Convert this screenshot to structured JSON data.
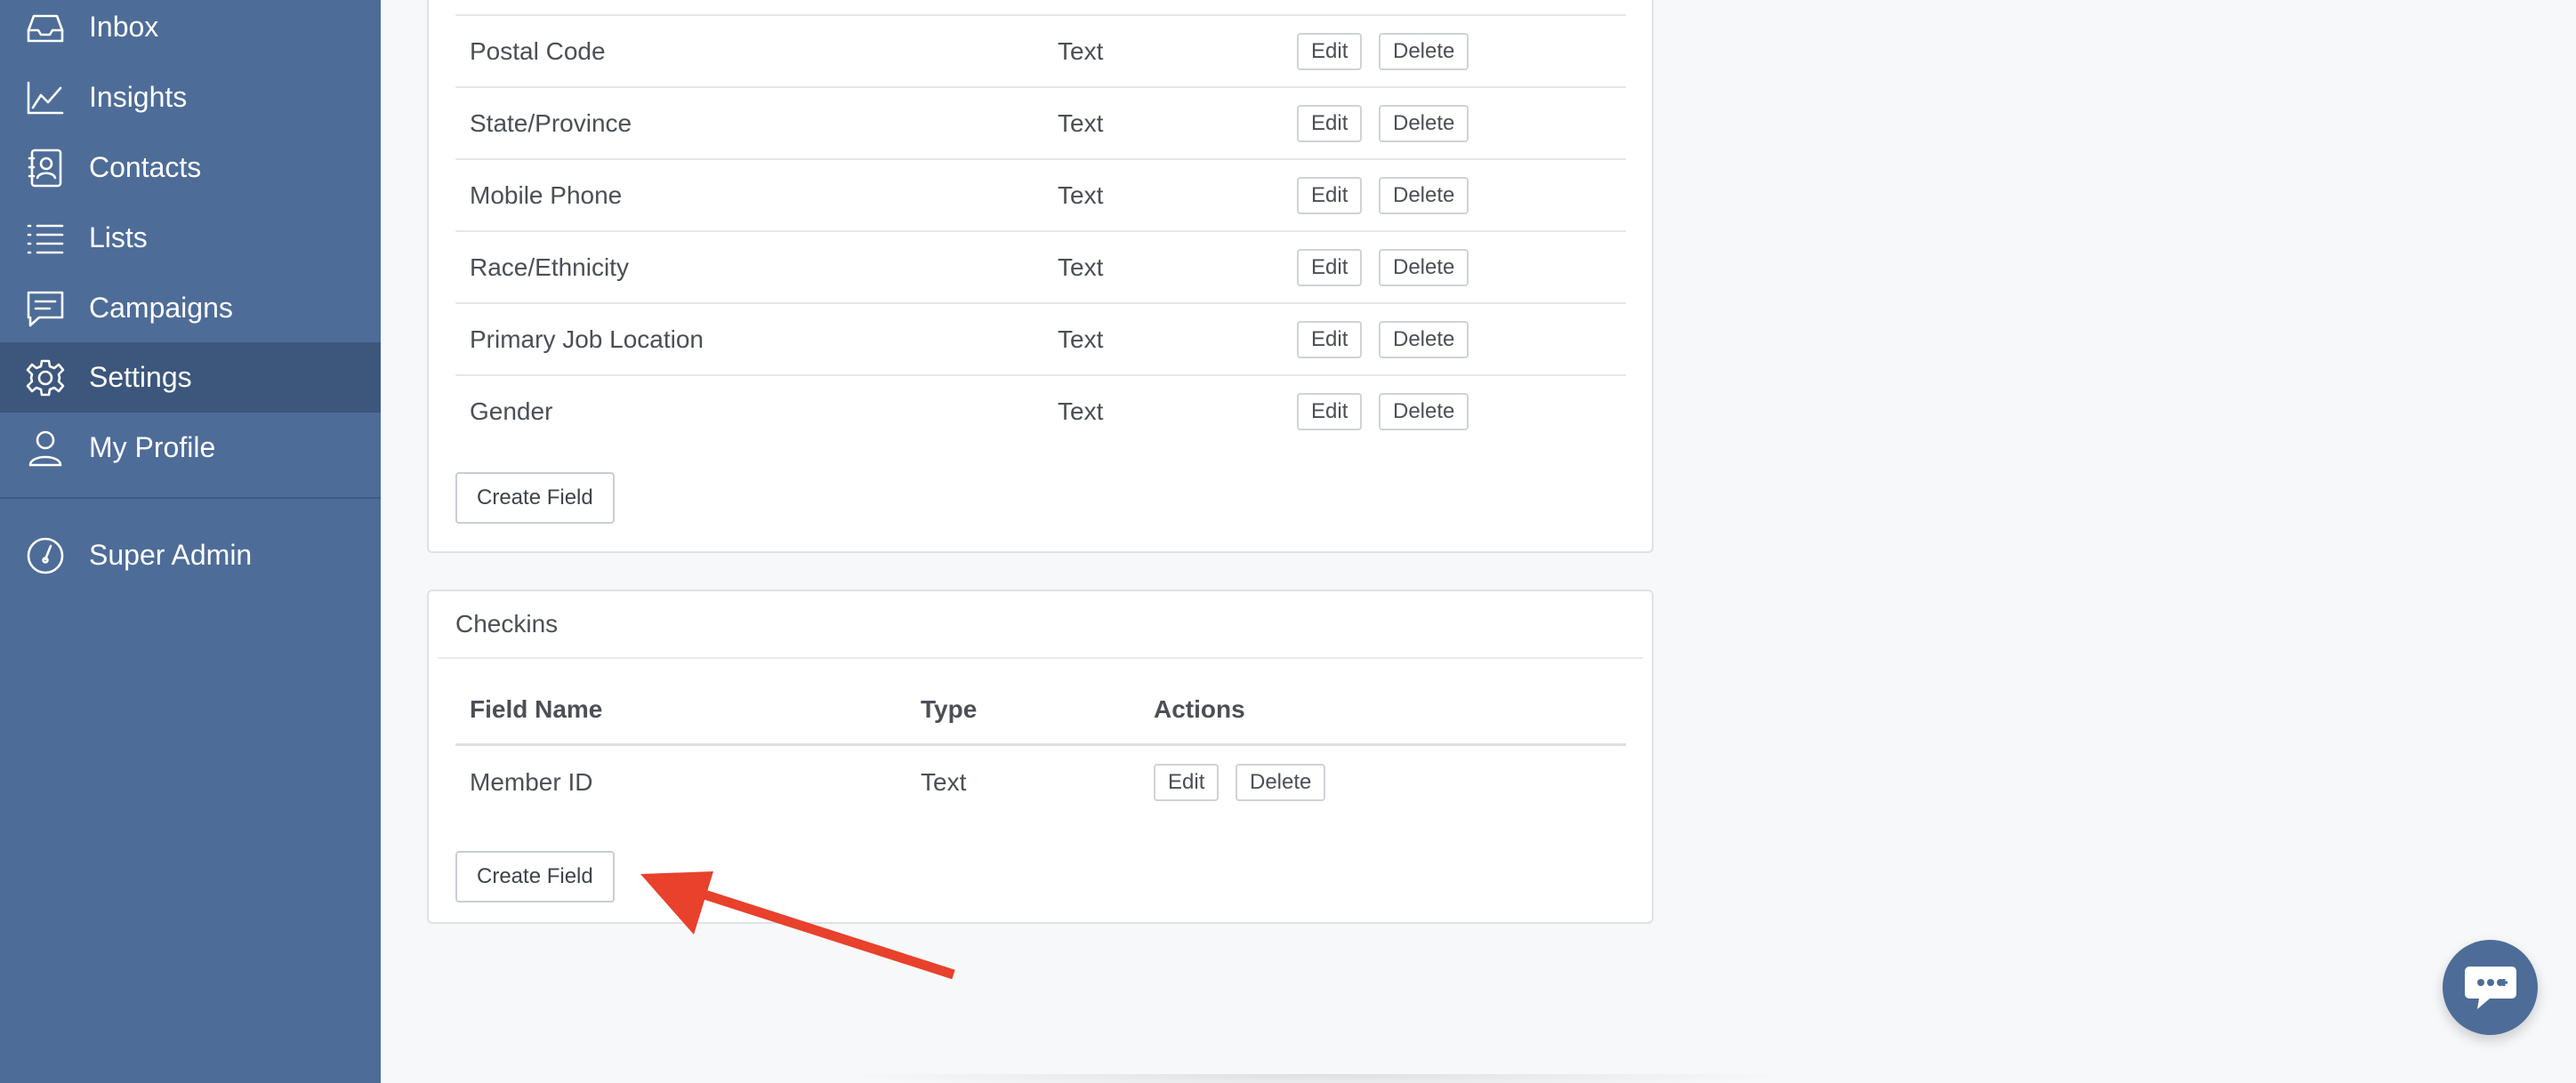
{
  "sidebar": {
    "items": [
      {
        "label": "Inbox",
        "icon": "inbox-icon"
      },
      {
        "label": "Insights",
        "icon": "chart-icon"
      },
      {
        "label": "Contacts",
        "icon": "contacts-icon"
      },
      {
        "label": "Lists",
        "icon": "list-icon"
      },
      {
        "label": "Campaigns",
        "icon": "message-icon"
      },
      {
        "label": "Settings",
        "icon": "gear-icon",
        "active": true
      },
      {
        "label": "My Profile",
        "icon": "user-icon"
      }
    ],
    "admin": {
      "label": "Super Admin",
      "icon": "gauge-icon"
    }
  },
  "custom_fields": {
    "rows": [
      {
        "name": "Postal Code",
        "type": "Text"
      },
      {
        "name": "State/Province",
        "type": "Text"
      },
      {
        "name": "Mobile Phone",
        "type": "Text"
      },
      {
        "name": "Race/Ethnicity",
        "type": "Text"
      },
      {
        "name": "Primary Job Location",
        "type": "Text"
      },
      {
        "name": "Gender",
        "type": "Text"
      }
    ],
    "edit_label": "Edit",
    "delete_label": "Delete",
    "create_label": "Create Field"
  },
  "checkins": {
    "title": "Checkins",
    "headers": {
      "name": "Field Name",
      "type": "Type",
      "actions": "Actions"
    },
    "rows": [
      {
        "name": "Member ID",
        "type": "Text"
      }
    ],
    "edit_label": "Edit",
    "delete_label": "Delete",
    "create_label": "Create Field"
  },
  "colors": {
    "sidebar": "#4d6c98",
    "sidebar_active": "#3c567c",
    "annotation_arrow": "#e8412c"
  },
  "chat": {
    "icon": "chat-bubble-icon"
  }
}
